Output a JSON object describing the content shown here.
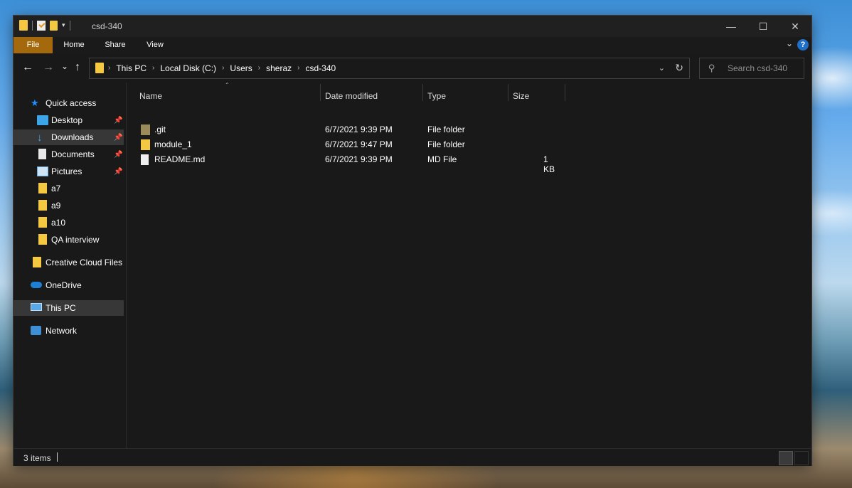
{
  "window": {
    "title": "csd-340"
  },
  "ribbon": {
    "tabs": [
      "File",
      "Home",
      "Share",
      "View"
    ],
    "help_label": "?"
  },
  "nav": {
    "back_glyph": "←",
    "forward_glyph": "→",
    "recent_glyph": "⌄",
    "up_glyph": "↑",
    "breadcrumb": [
      "This PC",
      "Local Disk (C:)",
      "Users",
      "sheraz",
      "csd-340"
    ],
    "search_placeholder": "Search csd-340"
  },
  "sidebar": {
    "quick_access": "Quick access",
    "items": [
      {
        "label": "Desktop",
        "icon": "desktop-icon",
        "pinned": true
      },
      {
        "label": "Downloads",
        "icon": "downloads-icon",
        "pinned": true,
        "selected": true
      },
      {
        "label": "Documents",
        "icon": "documents-icon",
        "pinned": true
      },
      {
        "label": "Pictures",
        "icon": "pictures-icon",
        "pinned": true
      },
      {
        "label": "a7",
        "icon": "folder-icon"
      },
      {
        "label": "a9",
        "icon": "folder-icon"
      },
      {
        "label": "a10",
        "icon": "folder-icon"
      },
      {
        "label": "QA interview",
        "icon": "folder-icon"
      }
    ],
    "creative_cloud": "Creative Cloud Files",
    "onedrive": "OneDrive",
    "this_pc": "This PC",
    "network": "Network"
  },
  "columns": {
    "name": "Name",
    "date": "Date modified",
    "type": "Type",
    "size": "Size"
  },
  "files": [
    {
      "name": ".git",
      "date": "6/7/2021 9:39 PM",
      "type": "File folder",
      "size": "",
      "icon": "git-folder-icon"
    },
    {
      "name": "module_1",
      "date": "6/7/2021 9:47 PM",
      "type": "File folder",
      "size": "",
      "icon": "folder-icon"
    },
    {
      "name": "README.md",
      "date": "6/7/2021 9:39 PM",
      "type": "MD File",
      "size": "1 KB",
      "icon": "file-icon"
    }
  ],
  "status": {
    "item_count": "3 items"
  },
  "colors": {
    "file_tab": "#a4690d",
    "folder": "#f5c842",
    "selected": "#373737",
    "accent": "#1f6fc8"
  }
}
